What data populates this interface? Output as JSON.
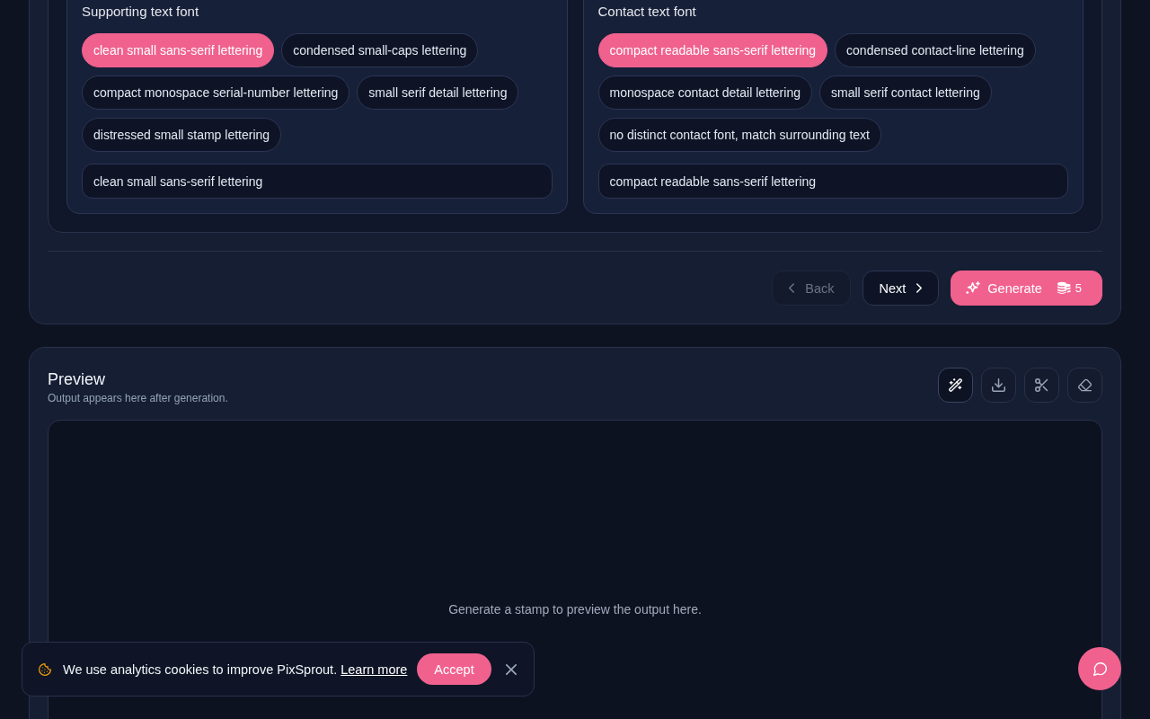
{
  "font_sections": [
    {
      "label": "Supporting text font",
      "options": [
        {
          "label": "clean small sans-serif lettering",
          "selected": true
        },
        {
          "label": "condensed small-caps lettering",
          "selected": false
        },
        {
          "label": "compact monospace serial-number lettering",
          "selected": false
        },
        {
          "label": "small serif detail lettering",
          "selected": false
        },
        {
          "label": "distressed small stamp lettering",
          "selected": false
        }
      ],
      "custom_input": {
        "value": "clean small sans-serif lettering"
      }
    },
    {
      "label": "Contact text font",
      "options": [
        {
          "label": "compact readable sans-serif lettering",
          "selected": true
        },
        {
          "label": "condensed contact-line lettering",
          "selected": false
        },
        {
          "label": "monospace contact detail lettering",
          "selected": false
        },
        {
          "label": "small serif contact lettering",
          "selected": false
        },
        {
          "label": "no distinct contact font, match surrounding text",
          "selected": false
        }
      ],
      "custom_input": {
        "value": "compact readable sans-serif lettering"
      }
    }
  ],
  "wizard_buttons": [
    {
      "kind": "back",
      "label": "Back",
      "disabled": true
    },
    {
      "kind": "next",
      "label": "Next",
      "disabled": false
    },
    {
      "kind": "generate",
      "label": "Generate",
      "cost": "5",
      "disabled": false
    }
  ],
  "preview": {
    "title": "Preview",
    "subtitle": "Output appears here after generation.",
    "tools": [
      {
        "kind": "wand",
        "selected": true
      },
      {
        "kind": "download",
        "selected": false
      },
      {
        "kind": "scissors",
        "selected": false
      },
      {
        "kind": "eraser",
        "selected": false
      }
    ],
    "empty_message": "Generate a stamp to preview the output here."
  },
  "cookie_banner": {
    "message": "We use analytics cookies to improve PixSprout.",
    "link": "Learn more",
    "accept": "Accept"
  }
}
